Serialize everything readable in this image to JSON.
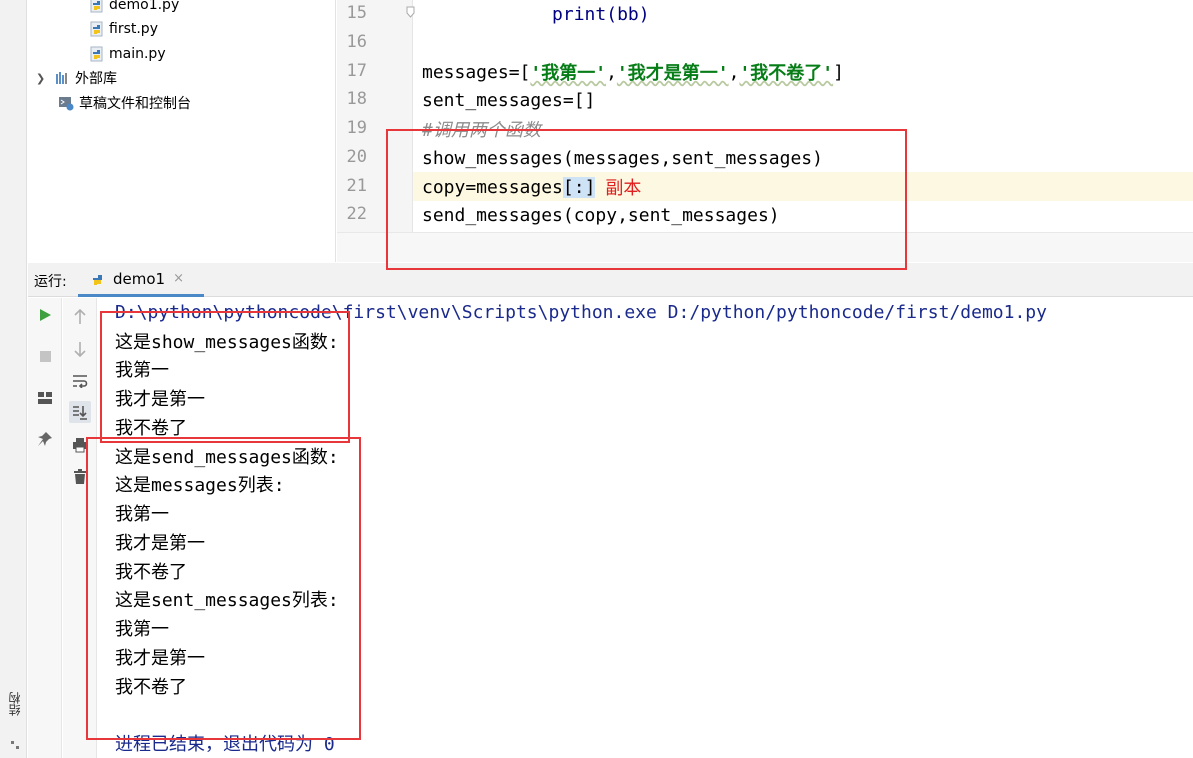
{
  "project_tree": {
    "items": [
      {
        "label": "demo1.py",
        "kind": "python-file"
      },
      {
        "label": "first.py",
        "kind": "python-file"
      },
      {
        "label": "main.py",
        "kind": "python-file"
      },
      {
        "label": "外部库",
        "kind": "library"
      },
      {
        "label": "草稿文件和控制台",
        "kind": "scratches"
      }
    ]
  },
  "editor": {
    "lines": [
      {
        "num": "15",
        "code": "            print(bb)"
      },
      {
        "num": "16",
        "code": ""
      },
      {
        "num": "17",
        "parts": [
          "messages=[",
          "'我第一'",
          ",",
          "'我才是第一'",
          ",",
          "'我不卷了'",
          "]"
        ]
      },
      {
        "num": "18",
        "code": "sent_messages=[]"
      },
      {
        "num": "19",
        "code": "#调用两个函数"
      },
      {
        "num": "20",
        "code": "show_messages(messages,sent_messages)"
      },
      {
        "num": "21",
        "parts": [
          "copy=messages",
          "[:]"
        ],
        "note": "副本"
      },
      {
        "num": "22",
        "code": "send_messages(copy,sent_messages)"
      }
    ]
  },
  "run_window": {
    "label": "运行:",
    "tab_label": "demo1",
    "close_glyph": "×"
  },
  "console": {
    "lines": [
      "D:\\python\\pythoncode\\first\\venv\\Scripts\\python.exe D:/python/pythoncode/first/demo1.py",
      "这是show_messages函数:",
      "我第一",
      "我才是第一",
      "我不卷了",
      "这是send_messages函数:",
      "这是messages列表:",
      "我第一",
      "我才是第一",
      "我不卷了",
      "这是sent_messages列表:",
      "我第一",
      "我才是第一",
      "我不卷了",
      "",
      "进程已结束，退出代码为 0"
    ]
  },
  "side_tabs": {
    "structure_label": "结构"
  },
  "colors": {
    "annotation_red": "#e8373a",
    "string_green": "#067d17",
    "current_line": "#fcf8e2",
    "selection": "#cfe3f7",
    "run_green": "#3ea03e",
    "path_blue": "#1a2a8c"
  }
}
